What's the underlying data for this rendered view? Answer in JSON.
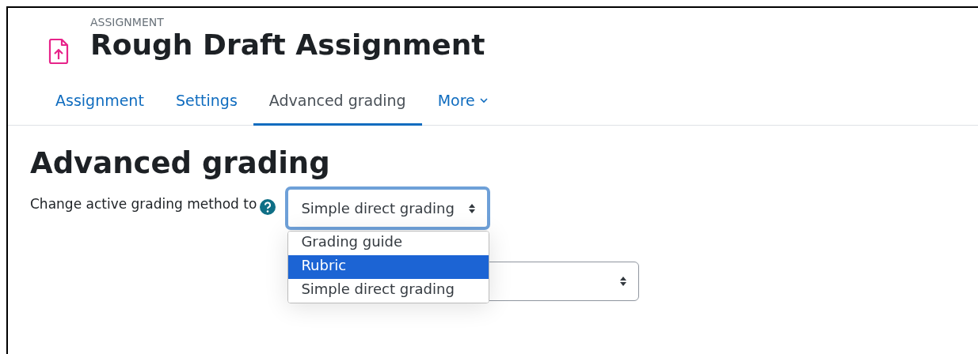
{
  "header": {
    "kicker": "ASSIGNMENT",
    "title": "Rough Draft Assignment"
  },
  "tabs": [
    {
      "label": "Assignment",
      "selected": false
    },
    {
      "label": "Settings",
      "selected": false
    },
    {
      "label": "Advanced grading",
      "selected": true
    },
    {
      "label": "More",
      "selected": false,
      "kind": "menu"
    }
  ],
  "heading": "Advanced grading",
  "method": {
    "label": "Change active grading method to",
    "value": "Simple direct grading",
    "expanded": true,
    "options": [
      {
        "label": "Grading guide",
        "highlighted": false
      },
      {
        "label": "Rubric",
        "highlighted": true
      },
      {
        "label": "Simple direct grading",
        "highlighted": false
      }
    ]
  }
}
